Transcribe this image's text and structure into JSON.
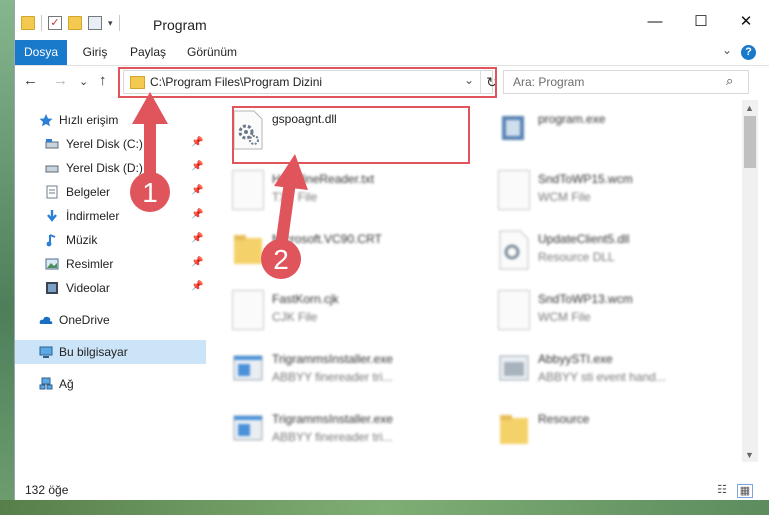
{
  "window": {
    "title": "Program",
    "controls": {
      "minimize": "—",
      "maximize": "☐",
      "close": "✕"
    }
  },
  "ribbon": {
    "tabs": [
      {
        "label": "Dosya",
        "active": true
      },
      {
        "label": "Giriş"
      },
      {
        "label": "Paylaş"
      },
      {
        "label": "Görünüm"
      }
    ]
  },
  "address": {
    "path": "C:\\Program Files\\Program Dizini",
    "refresh_icon": "↻",
    "dropdown_icon": "⌄"
  },
  "search": {
    "placeholder": "Ara: Program",
    "icon": "⌕"
  },
  "nav_buttons": {
    "back": "←",
    "forward": "→",
    "recent": "⌄",
    "up": "↑"
  },
  "sidebar": {
    "items": [
      {
        "label": "Hızlı erişim",
        "icon": "star-icon"
      },
      {
        "label": "Yerel Disk (C:)",
        "icon": "drive-icon",
        "pinned": true
      },
      {
        "label": "Yerel Disk (D:)",
        "icon": "drive-icon",
        "pinned": true
      },
      {
        "label": "Belgeler",
        "icon": "documents-icon",
        "pinned": true
      },
      {
        "label": "İndirmeler",
        "icon": "download-icon",
        "pinned": true
      },
      {
        "label": "Müzik",
        "icon": "music-icon",
        "pinned": true
      },
      {
        "label": "Resimler",
        "icon": "pictures-icon",
        "pinned": true
      },
      {
        "label": "Videolar",
        "icon": "video-icon",
        "pinned": true
      },
      {
        "label": "OneDrive",
        "icon": "cloud-icon"
      },
      {
        "label": "Bu bilgisayar",
        "icon": "computer-icon",
        "selected": true
      },
      {
        "label": "Ağ",
        "icon": "network-icon"
      }
    ]
  },
  "files": [
    {
      "name": "gspoagnt.dll",
      "sub": "",
      "icon": "dll-gear-icon"
    },
    {
      "name": "program.exe",
      "sub": "",
      "icon": "exe-icon"
    },
    {
      "name": "Help.fineReader.txt",
      "sub": "TXT File",
      "icon": "text-file-icon"
    },
    {
      "name": "SndToWP15.wcm",
      "sub": "WCM File",
      "icon": "blank-file-icon"
    },
    {
      "name": "Microsoft.VC90.CRT",
      "sub": "",
      "icon": "folder-icon"
    },
    {
      "name": "UpdateClient5.dll",
      "sub": "Resource DLL",
      "icon": "dll-gear-icon"
    },
    {
      "name": "FastKorn.cjk",
      "sub": "CJK File",
      "icon": "blank-file-icon"
    },
    {
      "name": "SndToWP13.wcm",
      "sub": "WCM File",
      "icon": "blank-file-icon"
    },
    {
      "name": "TrigrammsInstaller.exe",
      "sub": "ABBYY finereader tri...",
      "icon": "app-window-icon"
    },
    {
      "name": "AbbyySTI.exe",
      "sub": "ABBYY sti event hand...",
      "icon": "app-window-icon"
    },
    {
      "name": "TrigrammsInstaller.exe",
      "sub": "ABBYY finereader tri...",
      "icon": "app-window-icon"
    },
    {
      "name": "Resource",
      "sub": "",
      "icon": "folder-icon"
    }
  ],
  "annotations": {
    "step1": "1",
    "step2": "2",
    "accent": "#e0545c"
  },
  "status": {
    "count": "132 öğe"
  }
}
